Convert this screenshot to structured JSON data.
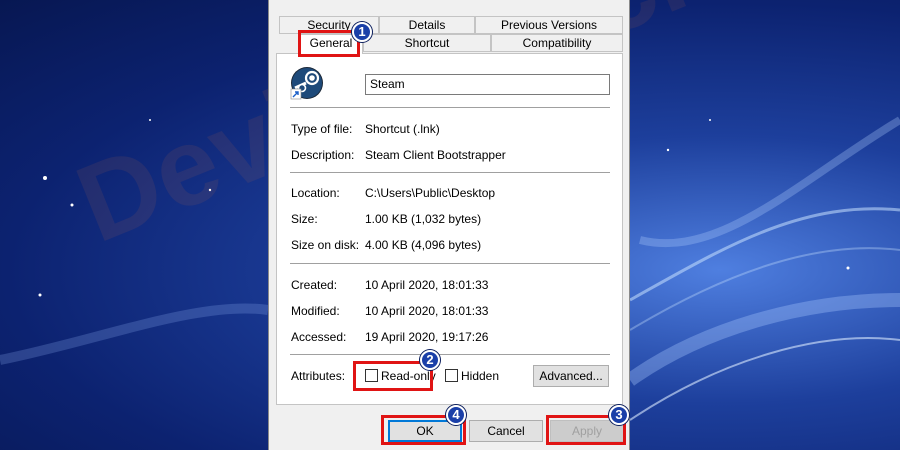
{
  "tabs_row1": [
    "Security",
    "Details",
    "Previous Versions"
  ],
  "tabs_row2": [
    "General",
    "Shortcut",
    "Compatibility"
  ],
  "general": {
    "name_value": "Steam",
    "type_label": "Type of file:",
    "type_value": "Shortcut (.lnk)",
    "description_label": "Description:",
    "description_value": "Steam Client Bootstrapper",
    "location_label": "Location:",
    "location_value": "C:\\Users\\Public\\Desktop",
    "size_label": "Size:",
    "size_value": "1.00 KB (1,032 bytes)",
    "size_on_disk_label": "Size on disk:",
    "size_on_disk_value": "4.00 KB (4,096 bytes)",
    "created_label": "Created:",
    "created_value": "10 April 2020, 18:01:33",
    "modified_label": "Modified:",
    "modified_value": "10 April 2020, 18:01:33",
    "accessed_label": "Accessed:",
    "accessed_value": "19 April 2020, 19:17:26",
    "attributes_label": "Attributes:",
    "readonly_label": "Read-only",
    "readonly_checked": false,
    "hidden_label": "Hidden",
    "hidden_checked": false,
    "advanced_label": "Advanced..."
  },
  "buttons": {
    "ok": "OK",
    "cancel": "Cancel",
    "apply": "Apply"
  },
  "annotations": [
    "1",
    "2",
    "3",
    "4"
  ],
  "watermark": "DevicesTricks",
  "colors": {
    "highlight": "#e01414",
    "badge": "#1a3fa8",
    "desktop": "#0c2270"
  }
}
